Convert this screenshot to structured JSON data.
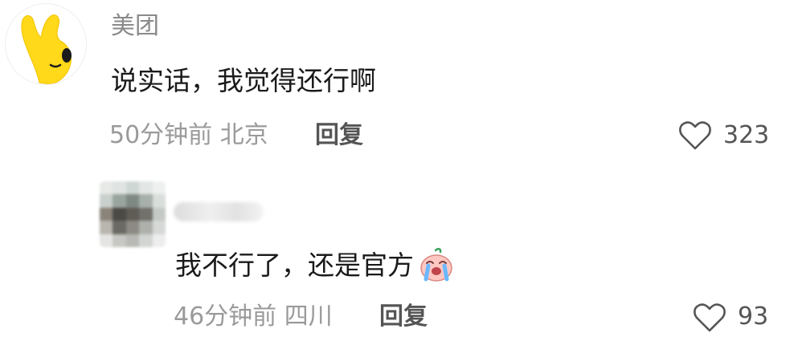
{
  "comment": {
    "author": "美团",
    "text": "说实话，我觉得还行啊",
    "time": "50分钟前",
    "location": "北京",
    "reply_label": "回复",
    "likes": "323"
  },
  "reply": {
    "author": "",
    "text": "我不行了，还是官方",
    "emoji_icon": "crying-face-icon",
    "time": "46分钟前",
    "location": "四川",
    "reply_label": "回复",
    "likes": "93"
  },
  "colors": {
    "avatar_yellow": "#ffd91a",
    "meta_gray": "#9a9a9a",
    "text_dark": "#1a1a1a"
  }
}
